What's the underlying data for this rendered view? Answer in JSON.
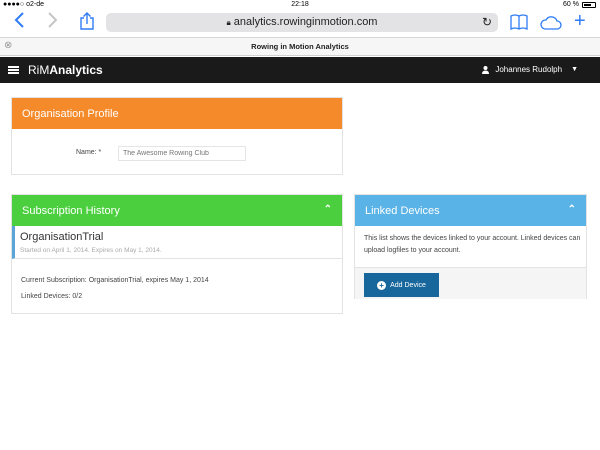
{
  "statusbar": {
    "carrier": "●●●●○ o2-de",
    "time": "22:18",
    "battery": "60 %"
  },
  "browser": {
    "url": "analytics.rowinginmotion.com",
    "tab_title": "Rowing in Motion Analytics"
  },
  "app": {
    "brand_prefix": "RiM",
    "brand_suffix": "Analytics",
    "user_name": "Johannes Rudolph"
  },
  "org_profile": {
    "title": "Organisation Profile",
    "name_label": "Name: *",
    "name_value": "The Awesome Rowing Club"
  },
  "subscription": {
    "title": "Subscription History",
    "entry_name": "OrganisationTrial",
    "entry_dates": "Started on April 1, 2014. Expires on May 1, 2014.",
    "current": "Current Subscription: OrganisationTrial, expires May 1, 2014",
    "linked": "Linked Devices: 0/2"
  },
  "devices": {
    "title": "Linked Devices",
    "description": "This list shows the devices linked to your account. Linked devices can upload logfiles to your account.",
    "add_label": "Add Device"
  },
  "colors": {
    "org_header": "#f58a2a",
    "subscription_header": "#4ccf3f",
    "devices_header": "#5ab3e6",
    "add_button": "#17679c",
    "appbar": "#1a1a1a",
    "ios_blue": "#2f7cf6"
  }
}
